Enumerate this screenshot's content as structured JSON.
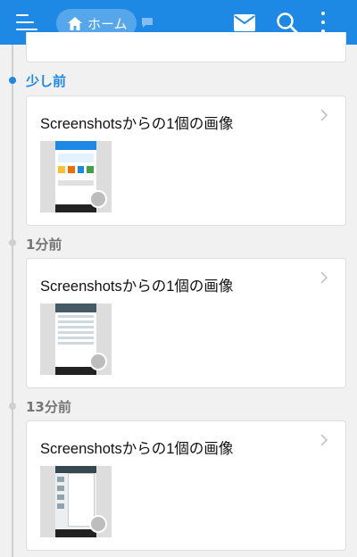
{
  "appbar": {
    "home_label": "ホーム",
    "icons": [
      "menu-icon",
      "home-icon",
      "chat-icon",
      "mail-icon",
      "search-icon",
      "more-vert-icon"
    ],
    "color": "#1e88e5"
  },
  "timeline": {
    "sections": [
      {
        "label": "少し前",
        "active": true,
        "card_title": "Screenshotsからの1個の画像"
      },
      {
        "label": "1分前",
        "active": false,
        "card_title": "Screenshotsからの1個の画像"
      },
      {
        "label": "13分前",
        "active": false,
        "card_title": "Screenshotsからの1個の画像"
      }
    ]
  }
}
